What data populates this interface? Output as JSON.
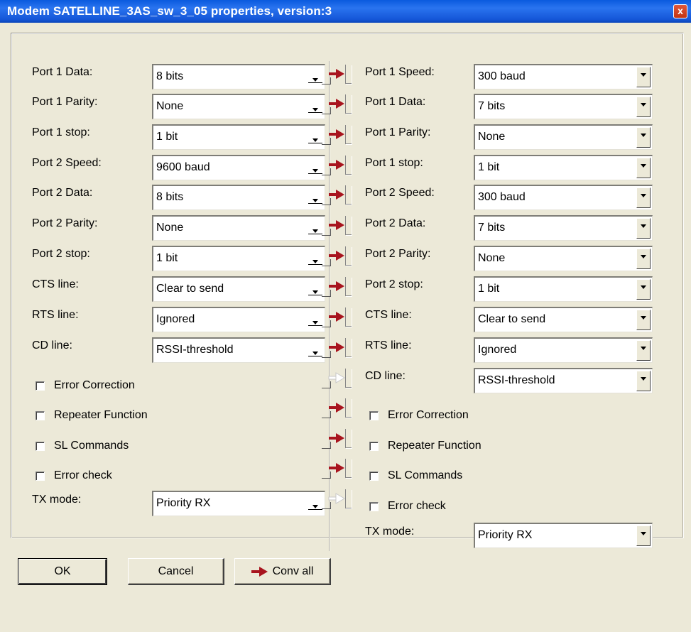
{
  "window": {
    "title": "Modem SATELLINE_3AS_sw_3_05 properties, version:3",
    "close_label": "x"
  },
  "left": {
    "combos": [
      {
        "label": "Port 1 Data:",
        "value": "8 bits"
      },
      {
        "label": "Port 1 Parity:",
        "value": "None"
      },
      {
        "label": "Port 1 stop:",
        "value": "1 bit"
      },
      {
        "label": "Port 2 Speed:",
        "value": "9600 baud"
      },
      {
        "label": "Port 2 Data:",
        "value": "8 bits"
      },
      {
        "label": "Port 2 Parity:",
        "value": "None"
      },
      {
        "label": "Port 2 stop:",
        "value": "1 bit"
      },
      {
        "label": "CTS line:",
        "value": "Clear to send"
      },
      {
        "label": "RTS line:",
        "value": "Ignored"
      },
      {
        "label": "CD line:",
        "value": "RSSI-threshold"
      }
    ],
    "checks": [
      {
        "label": "Error Correction",
        "checked": false
      },
      {
        "label": "Repeater Function",
        "checked": false
      },
      {
        "label": "SL Commands",
        "checked": false
      },
      {
        "label": "Error check",
        "checked": false
      }
    ],
    "tx_mode": {
      "label": "TX mode:",
      "value": "Priority RX"
    }
  },
  "right": {
    "combos": [
      {
        "label": "Port 1 Speed:",
        "value": "300 baud"
      },
      {
        "label": "Port 1 Data:",
        "value": "7 bits"
      },
      {
        "label": "Port 1 Parity:",
        "value": "None"
      },
      {
        "label": "Port 1 stop:",
        "value": "1 bit"
      },
      {
        "label": "Port 2 Speed:",
        "value": "300 baud"
      },
      {
        "label": "Port 2 Data:",
        "value": "7 bits"
      },
      {
        "label": "Port 2 Parity:",
        "value": "None"
      },
      {
        "label": "Port 2 stop:",
        "value": "1 bit"
      },
      {
        "label": "CTS line:",
        "value": "Clear to send"
      },
      {
        "label": "RTS line:",
        "value": "Ignored"
      },
      {
        "label": "CD line:",
        "value": "RSSI-threshold"
      }
    ],
    "checks": [
      {
        "label": "Error Correction",
        "checked": false
      },
      {
        "label": "Repeater Function",
        "checked": false
      },
      {
        "label": "SL Commands",
        "checked": false
      },
      {
        "label": "Error check",
        "checked": false
      }
    ],
    "tx_mode": {
      "label": "TX mode:",
      "value": "Priority RX"
    }
  },
  "convert_buttons": [
    {
      "row": "Port 1 Data",
      "enabled": true
    },
    {
      "row": "Port 1 Parity",
      "enabled": true
    },
    {
      "row": "Port 1 stop",
      "enabled": true
    },
    {
      "row": "Port 2 Speed",
      "enabled": true
    },
    {
      "row": "Port 2 Data",
      "enabled": true
    },
    {
      "row": "Port 2 Parity",
      "enabled": true
    },
    {
      "row": "Port 2 stop",
      "enabled": true
    },
    {
      "row": "CTS line",
      "enabled": true
    },
    {
      "row": "RTS line",
      "enabled": true
    },
    {
      "row": "CD line",
      "enabled": true
    },
    {
      "row": "Error Correction",
      "enabled": false
    },
    {
      "row": "Repeater Function",
      "enabled": true
    },
    {
      "row": "SL Commands",
      "enabled": true
    },
    {
      "row": "Error check",
      "enabled": true
    },
    {
      "row": "TX mode",
      "enabled": false
    }
  ],
  "buttons": {
    "ok": "OK",
    "cancel": "Cancel",
    "conv_all": "Conv all"
  },
  "colors": {
    "titlebar": "#1556d8",
    "dialog_bg": "#ece9d8",
    "arrow_enabled": "#a8141e",
    "arrow_disabled": "#c8c8c8"
  },
  "icons": {
    "convert": "red-right-arrow-icon",
    "close": "close-icon"
  }
}
